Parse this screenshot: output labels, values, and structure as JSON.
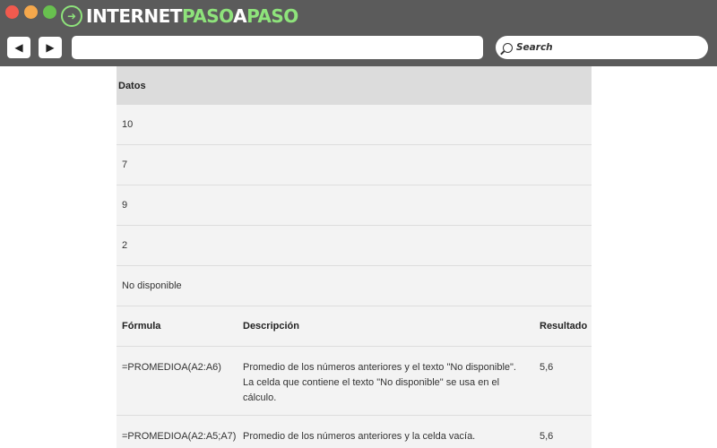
{
  "browser": {
    "logo": {
      "part1": "INTERNET",
      "part2": "PASO",
      "part3": "A",
      "part4": "PASO"
    },
    "nav": {
      "back_glyph": "◀",
      "forward_glyph": "▶"
    },
    "url": {
      "value": ""
    },
    "search": {
      "placeholder": "Search"
    }
  },
  "table": {
    "data_header": "Datos",
    "data_rows": [
      "10",
      "7",
      "9",
      "2",
      "No disponible"
    ],
    "formula_headers": {
      "formula": "Fórmula",
      "description": "Descripción",
      "result": "Resultado"
    },
    "formula_rows": [
      {
        "formula": "=PROMEDIOA(A2:A6)",
        "description": "Promedio de los números anteriores y el texto \"No disponible\". La celda que contiene el texto \"No disponible\" se usa en el cálculo.",
        "result": "5,6"
      },
      {
        "formula": "=PROMEDIOA(A2:A5;A7)",
        "description": "Promedio de los números anteriores y la celda vacía.",
        "result": "5,6"
      }
    ]
  },
  "colors": {
    "chrome": "#5b5b5b",
    "close": "#f15a4e",
    "minimize": "#f5a84c",
    "maximize": "#68c04f",
    "brand_green": "#8ee37b",
    "table_header": "#dcdcdc",
    "table_row": "#f3f3f3"
  }
}
